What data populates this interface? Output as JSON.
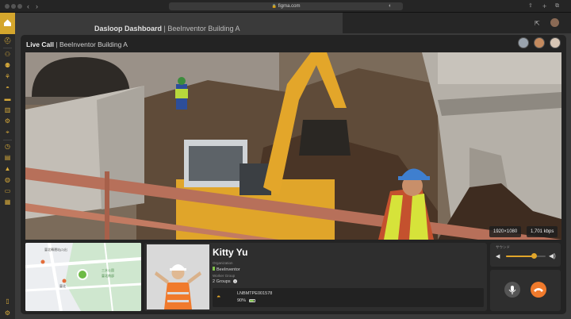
{
  "browser": {
    "url": "figma.com"
  },
  "sidebar": {
    "icons": [
      "home-icon",
      "analytics-icon",
      "people-icon",
      "workers-icon",
      "environment-icon",
      "helmet-icon",
      "truck-icon",
      "structure-icon",
      "equipment-icon",
      "pin-icon",
      "clock-icon",
      "document-icon",
      "alert-icon",
      "camera-icon",
      "report-icon",
      "building-icon",
      "book-icon",
      "settings-icon"
    ]
  },
  "backdrop": {
    "app_title": "Dasloop Dashboard",
    "separator": "|",
    "project": "BeeInventor Building A"
  },
  "call": {
    "label": "Live Call",
    "separator": "|",
    "project": "BeeInventor Building A",
    "resolution": "1920×1080",
    "bitrate": "1,701 kbps"
  },
  "profile": {
    "name": "Kitty Yu",
    "org_label": "Organization",
    "org_value": "BeeInventor",
    "group_label": "Worker Group",
    "group_value": "2 Groups",
    "device_id": "LNBMTPE001578",
    "battery": "90%"
  },
  "volume": {
    "label": "サウンド",
    "level": 0.7
  },
  "map": {
    "labels": [
      "臺北轉運站(2)出",
      "三水公園",
      "臺北南部",
      "臺北"
    ]
  },
  "colors": {
    "accent": "#d4a62d",
    "hangup": "#f07a2c",
    "battery": "#7fc24a"
  }
}
